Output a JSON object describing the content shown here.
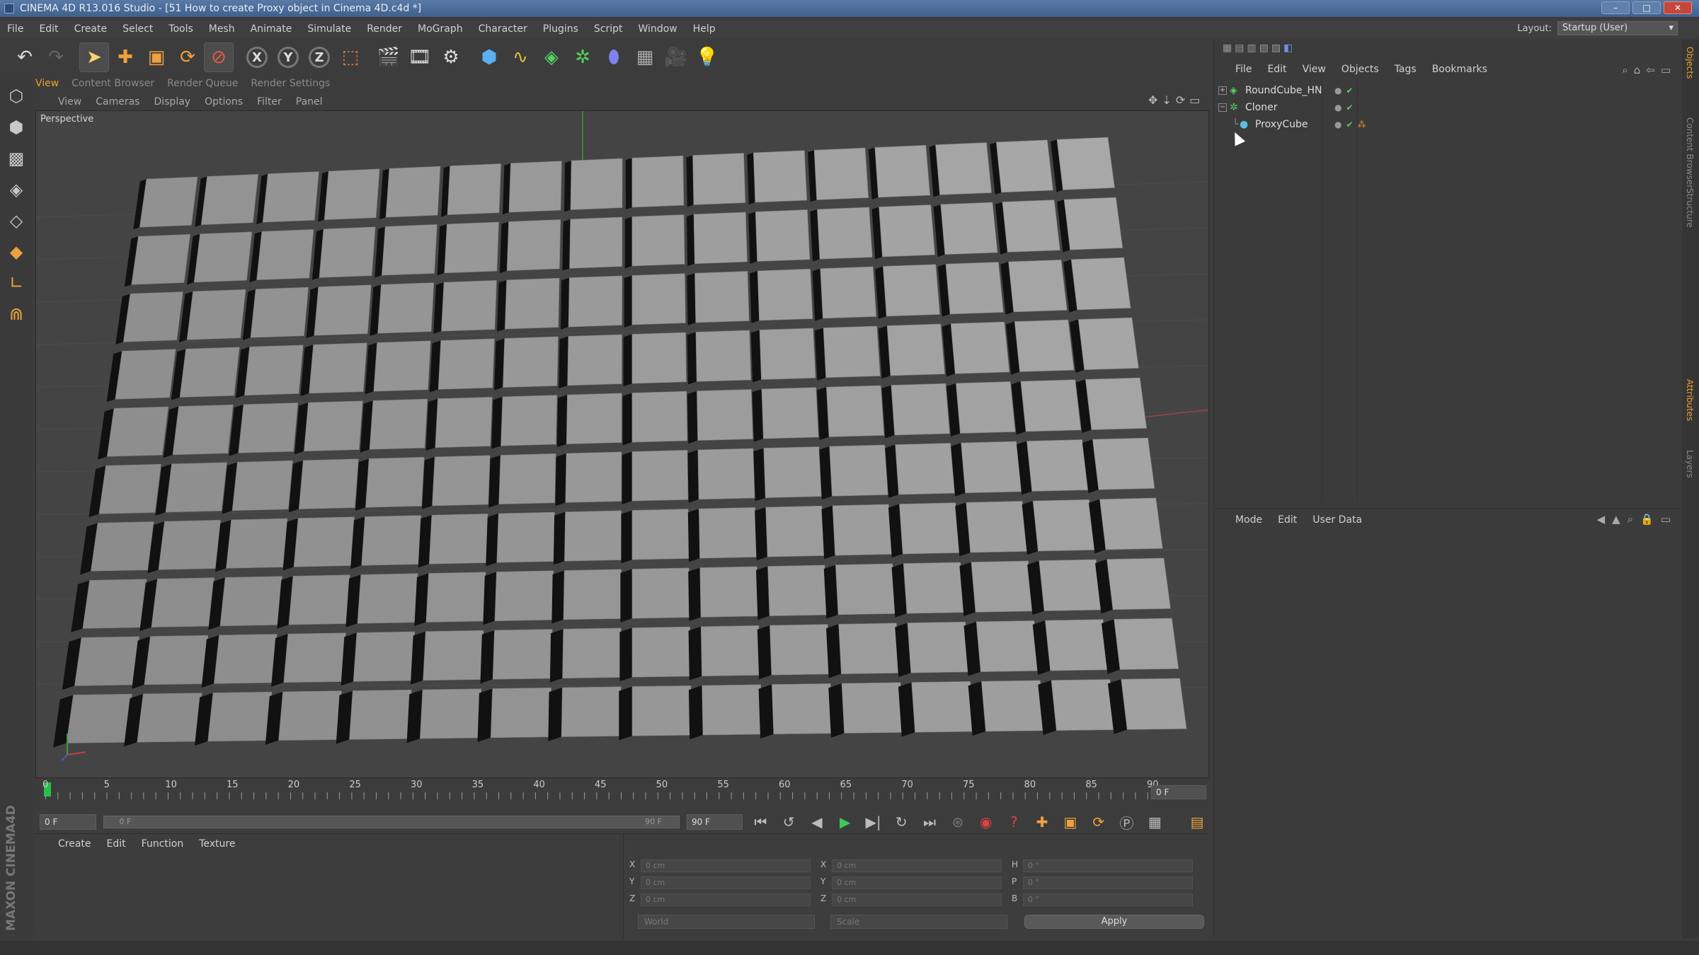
{
  "window": {
    "title": "CINEMA 4D R13.016 Studio - [51 How to create Proxy object in Cinema 4D.c4d *]",
    "buttons": [
      "–",
      "□",
      "✕"
    ]
  },
  "menubar": [
    "File",
    "Edit",
    "Create",
    "Select",
    "Tools",
    "Mesh",
    "Animate",
    "Simulate",
    "Render",
    "MoGraph",
    "Character",
    "Plugins",
    "Script",
    "Window",
    "Help"
  ],
  "layout": {
    "label": "Layout:",
    "value": "Startup (User)"
  },
  "toolbar": {
    "groups": [
      [
        "undo-icon",
        "redo-icon"
      ],
      [
        "select-arrow-icon",
        "move-icon",
        "scale-icon",
        "rotate-icon",
        "live-select-icon"
      ],
      [
        "x-axis-icon",
        "y-axis-icon",
        "z-axis-icon",
        "coordinate-system-icon"
      ],
      [
        "render-view-icon",
        "render-picture-viewer-icon",
        "edit-render-settings-icon"
      ],
      [
        "cube-primitive-icon",
        "spline-pen-icon",
        "subdivision-surface-icon",
        "cloner-icon",
        "deformer-icon",
        "floor-icon",
        "camera-icon",
        "light-icon"
      ]
    ],
    "axis_letters": [
      "X",
      "Y",
      "Z"
    ]
  },
  "left_tools": [
    "make-editable-icon",
    "texture-mode-icon",
    "point-mode-icon",
    "edge-mode-icon",
    "polygon-mode-icon",
    "axis-mode-icon",
    "magnet-icon"
  ],
  "brand_logo": "MAXON CINEMA4D",
  "view_tabs": [
    "View",
    "Content Browser",
    "Render Queue",
    "Render Settings"
  ],
  "view_menu": [
    "View",
    "Cameras",
    "Display",
    "Options",
    "Filter",
    "Panel"
  ],
  "viewport": {
    "label": "Perspective",
    "grid_rows": 10,
    "grid_cols": 16
  },
  "timeline": {
    "ticks": [
      "0",
      "5",
      "10",
      "15",
      "20",
      "25",
      "30",
      "35",
      "40",
      "45",
      "50",
      "55",
      "60",
      "65",
      "70",
      "75",
      "80",
      "85",
      "90"
    ],
    "current_frame": "0 F"
  },
  "transport": {
    "start": "0 F",
    "range_start": "0 F",
    "range_end": "90 F",
    "end": "90 F"
  },
  "material_menu": [
    "Create",
    "Edit",
    "Function",
    "Texture"
  ],
  "coordinates": {
    "rows": [
      {
        "a": "X",
        "av": "0 cm",
        "b": "X",
        "bv": "0 cm",
        "c": "H",
        "cv": "0 °"
      },
      {
        "a": "Y",
        "av": "0 cm",
        "b": "Y",
        "bv": "0 cm",
        "c": "P",
        "cv": "0 °"
      },
      {
        "a": "Z",
        "av": "0 cm",
        "b": "Z",
        "bv": "0 cm",
        "c": "B",
        "cv": "0 °"
      }
    ],
    "world": "World",
    "scale": "Scale",
    "apply": "Apply"
  },
  "object_manager": {
    "menu": [
      "File",
      "Edit",
      "View",
      "Objects",
      "Tags",
      "Bookmarks"
    ],
    "objects": [
      {
        "name": "RoundCube_HN",
        "expand": "+",
        "icon": "subdivision-surface-icon",
        "indent": 0
      },
      {
        "name": "Cloner",
        "expand": "−",
        "icon": "cloner-icon",
        "indent": 0
      },
      {
        "name": "ProxyCube",
        "expand": "",
        "icon": "instance-icon",
        "indent": 1
      }
    ]
  },
  "attribute_manager": {
    "menu": [
      "Mode",
      "Edit",
      "User Data"
    ]
  },
  "side_tabs": [
    "Objects",
    "Content Browser",
    "Structure",
    "Attributes",
    "Layers"
  ],
  "colors": {
    "accent": "#e8a030",
    "panel": "#3b3b3b",
    "viewport": "#444444",
    "cube": "#9a9a9a",
    "play": "#3ac95a"
  }
}
